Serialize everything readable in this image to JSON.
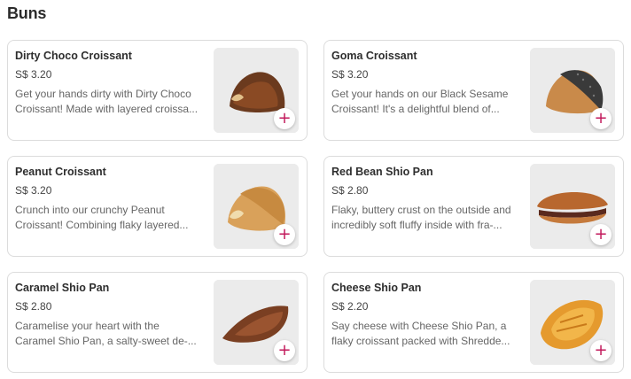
{
  "section": {
    "title": "Buns"
  },
  "items": [
    {
      "name": "Dirty Choco Croissant",
      "price": "S$ 3.20",
      "desc1": "Get your hands dirty with Dirty Choco",
      "desc2": "Croissant! Made with layered croissa...",
      "add_label": "+"
    },
    {
      "name": "Goma Croissant",
      "price": "S$ 3.20",
      "desc1": "Get your hands on our Black Sesame",
      "desc2": "Croissant! It's a delightful blend of...",
      "add_label": "+"
    },
    {
      "name": "Peanut Croissant",
      "price": "S$ 3.20",
      "desc1": "Crunch into our crunchy Peanut",
      "desc2": "Croissant! Combining flaky layered...",
      "add_label": "+"
    },
    {
      "name": "Red Bean Shio Pan",
      "price": "S$ 2.80",
      "desc1": "Flaky, buttery crust on the outside and",
      "desc2": "incredibly soft fluffy inside with fra-...",
      "add_label": "+"
    },
    {
      "name": "Caramel Shio Pan",
      "price": "S$ 2.80",
      "desc1": "Caramelise your heart with the",
      "desc2": "Caramel Shio Pan, a salty-sweet de-...",
      "add_label": "+"
    },
    {
      "name": "Cheese Shio Pan",
      "price": "S$ 2.20",
      "desc1": "Say cheese with Cheese Shio Pan, a",
      "desc2": "flaky croissant packed with Shredde...",
      "add_label": "+"
    }
  ],
  "colors": {
    "accent": "#c2185b",
    "card_border": "#dcdcdc",
    "thumb_bg": "#e8e8e8"
  },
  "icons": {
    "add": "plus-icon"
  }
}
